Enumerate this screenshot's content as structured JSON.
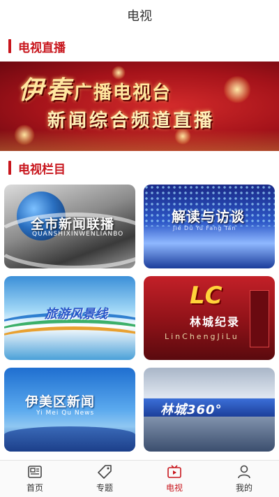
{
  "header": {
    "title": "电视"
  },
  "live_section": {
    "title": "电视直播",
    "banner": {
      "line1_big": "伊春",
      "line1_small": "广播电视台",
      "line2": "新闻综合频道直播"
    }
  },
  "columns_section": {
    "title": "电视栏目",
    "programs": [
      {
        "title": "全市新闻联播",
        "subtitle": "QUANSHIXINWENLIANBO"
      },
      {
        "title": "解读与访谈",
        "subtitle": "Jie Du Yu Fang Tan"
      },
      {
        "title": "旅游风景线"
      },
      {
        "logo": "LC",
        "title": "林城纪录",
        "subtitle": "LinChengJiLu"
      },
      {
        "title": "伊美区新闻",
        "subtitle": "Yi Mei Qu News"
      },
      {
        "title": "林城360°"
      }
    ]
  },
  "tabbar": {
    "items": [
      {
        "label": "首页",
        "icon": "home-news-icon"
      },
      {
        "label": "专题",
        "icon": "tag-icon"
      },
      {
        "label": "电视",
        "icon": "tv-icon"
      },
      {
        "label": "我的",
        "icon": "person-icon"
      }
    ],
    "active_color": "#c8161d"
  }
}
